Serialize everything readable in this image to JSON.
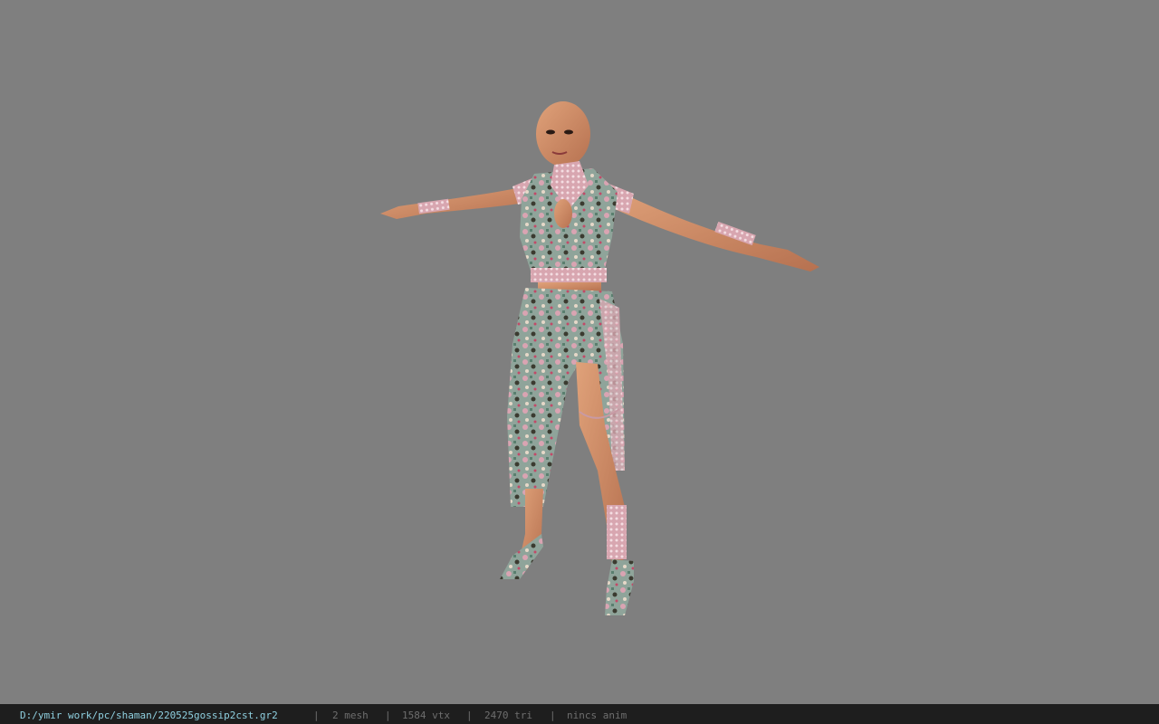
{
  "viewer": {
    "background_color": "#7f7f7f",
    "model_name": "character-model"
  },
  "status_bar": {
    "file_path": "D:/ymir work/pc/shaman/220525gossip2cst.gr2",
    "sep": "|",
    "mesh_count": "2 mesh",
    "vertex_count": "1584 vtx",
    "triangle_count": "2470 tri",
    "anim_status": "nincs anim",
    "path_color": "#8fd0e0",
    "text_color": "#6e6e6e",
    "bg_color": "#1e1e1e"
  }
}
